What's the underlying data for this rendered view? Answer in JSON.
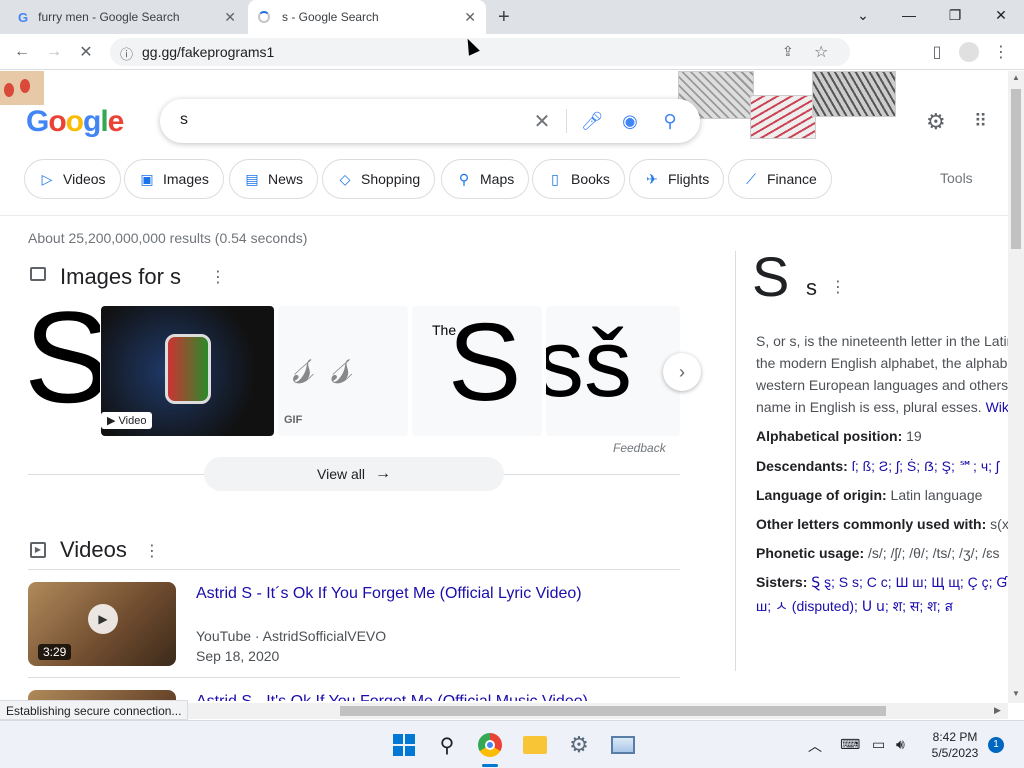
{
  "tabs": [
    {
      "title": "furry men - Google Search",
      "favicon": "google-g-icon"
    },
    {
      "title": "s - Google Search",
      "favicon": "loading-spinner-icon"
    }
  ],
  "omnibox": {
    "url": "gg.gg/fakeprograms1"
  },
  "search": {
    "query": "s"
  },
  "logo": {
    "letters": [
      "G",
      "o",
      "o",
      "g",
      "l",
      "e"
    ]
  },
  "chips": [
    {
      "label": "Videos",
      "icon": "video-icon"
    },
    {
      "label": "Images",
      "icon": "image-icon"
    },
    {
      "label": "News",
      "icon": "news-icon"
    },
    {
      "label": "Shopping",
      "icon": "tag-icon"
    },
    {
      "label": "Maps",
      "icon": "map-pin-icon"
    },
    {
      "label": "Books",
      "icon": "book-icon"
    },
    {
      "label": "Flights",
      "icon": "plane-icon"
    },
    {
      "label": "Finance",
      "icon": "finance-icon"
    }
  ],
  "tools_label": "Tools",
  "result_stats": "About 25,200,000,000 results (0.54 seconds)",
  "images_section": {
    "title": "Images for s",
    "thumb1_letter": "S",
    "thumb2_badge": "Video",
    "thumb3_badge": "GIF",
    "thumb4_the": "The",
    "thumb4_letter": "S",
    "thumb5_letters": "sš",
    "feedback": "Feedback",
    "view_all": "View all"
  },
  "videos_section": {
    "title": "Videos",
    "items": [
      {
        "title": "Astrid S - It´s Ok If You Forget Me (Official Lyric Video)",
        "source": "YouTube · AstridSofficialVEVO",
        "date": "Sep 18, 2020",
        "duration": "3:29"
      },
      {
        "title": "Astrid S - It's Ok If You Forget Me (Official Music Video)"
      }
    ]
  },
  "knowledge_panel": {
    "big_letter": "S",
    "small_letter": "s",
    "description_lines": [
      "S, or s, is the nineteenth letter in the Latin",
      "the modern English alphabet, the alphabe",
      "western European languages and others",
      "name in English is ess, plural esses."
    ],
    "wiki_link": "Wiki",
    "facts": [
      {
        "label": "Alphabetical position:",
        "value": " 19"
      },
      {
        "label": "Descendants:",
        "value": " ſ; ß; Ƨ; ʃ; Ṡ; ẞ; Ş; ℠; ч; ʃ"
      },
      {
        "label": "Language of origin:",
        "value": " Latin language"
      },
      {
        "label": "Other letters commonly used with:",
        "value": " s(x),"
      },
      {
        "label": "Phonetic usage:",
        "value": " /s/; /ʃ/; /θ/; /ts/; /ʒ/; /ɛs"
      },
      {
        "label": "Sisters:",
        "value": " Ȿ ȿ; Ѕ ѕ; С с; Ш ш; Щ щ; Ç ç; Ɠ ɠ"
      }
    ],
    "sisters_line2": "ш; ㅅ (disputed); Ս ս; श; स; श; ส"
  },
  "status_bar": "Establishing secure connection...",
  "clock": {
    "time": "8:42 PM",
    "date": "5/5/2023"
  },
  "notification_count": "1",
  "colors": {
    "google_blue": "#4285f4",
    "google_red": "#ea4335",
    "google_yellow": "#fbbc05",
    "google_green": "#34a853",
    "link": "#1a0dab"
  }
}
